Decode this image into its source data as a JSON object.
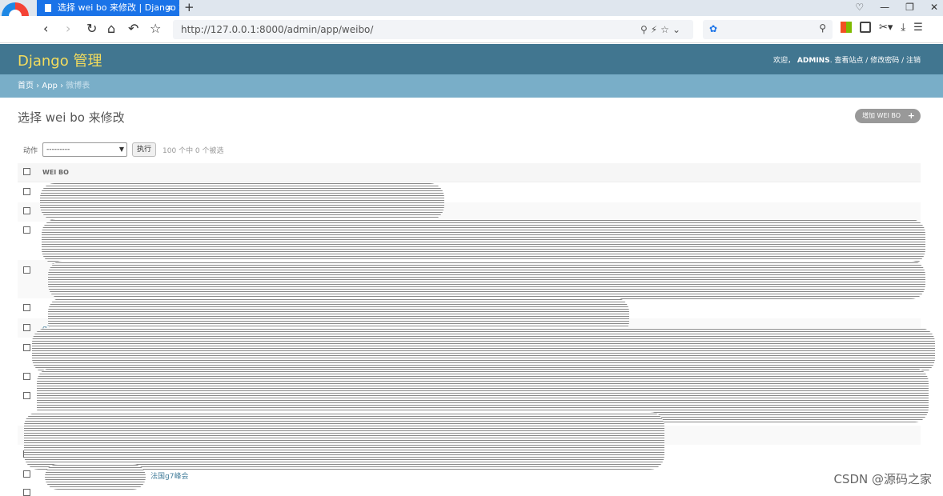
{
  "browser": {
    "tab_title": "选择 wei bo 来修改 | Django 站",
    "tab_close": "×",
    "new_tab": "+",
    "url": "http://127.0.0.1:8000/admin/app/weibo/"
  },
  "header": {
    "brand": "Django 管理",
    "welcome": "欢迎，",
    "username": "ADMINS",
    "view_site": "查看站点",
    "change_password": "修改密码",
    "logout": "注销"
  },
  "breadcrumbs": {
    "home": "首页",
    "app": "App",
    "current": "微博表"
  },
  "content": {
    "title": "选择 wei bo 来修改",
    "add_button": "增加 WEI BO"
  },
  "actions": {
    "label": "动作",
    "selected_option": "---------",
    "go": "执行",
    "count": "100 个中 0 个被选"
  },
  "table": {
    "column_header": "WEI BO",
    "visible_fragments": [
      "【",
      "g7",
      "法国g7峰会"
    ]
  },
  "watermark": "CSDN @源码之家"
}
